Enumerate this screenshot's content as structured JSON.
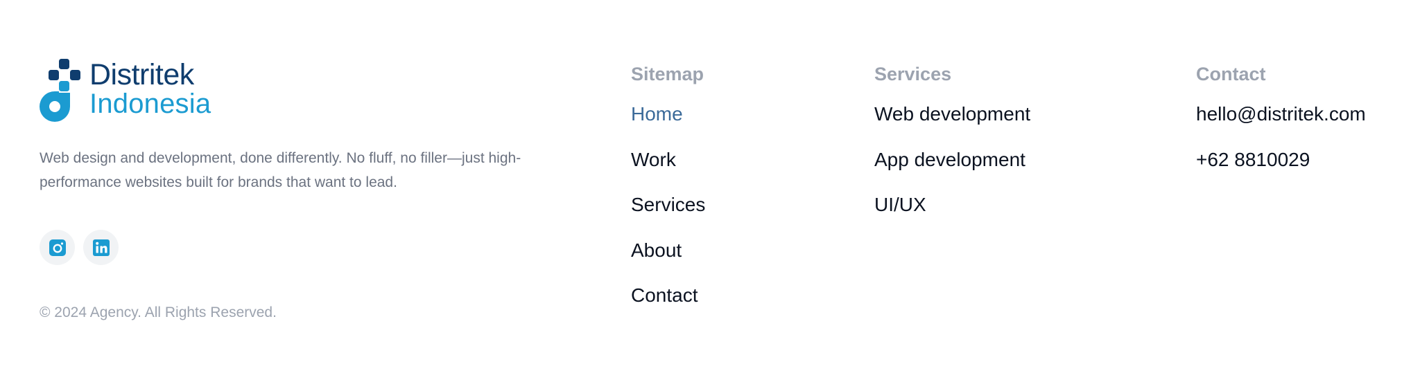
{
  "brand": {
    "name": "Distritek",
    "sub": "Indonesia",
    "colors": {
      "dark": "#0f3d6e",
      "light": "#1b9bd1"
    }
  },
  "tagline": "Web design and development, done differently. No fluff, no filler—just high-performance websites built for brands that want to lead.",
  "socials": [
    {
      "icon": "instagram-icon"
    },
    {
      "icon": "linkedin-icon"
    }
  ],
  "copyright": "© 2024 Agency. All Rights Reserved.",
  "sitemap": {
    "heading": "Sitemap",
    "items": [
      {
        "label": "Home",
        "active": true
      },
      {
        "label": "Work"
      },
      {
        "label": "Services"
      },
      {
        "label": "About"
      },
      {
        "label": "Contact"
      }
    ]
  },
  "services": {
    "heading": "Services",
    "items": [
      {
        "label": "Web development"
      },
      {
        "label": "App development"
      },
      {
        "label": "UI/UX"
      }
    ]
  },
  "contact": {
    "heading": "Contact",
    "email": "hello@distritek.com",
    "phone": "+62 8810029"
  }
}
